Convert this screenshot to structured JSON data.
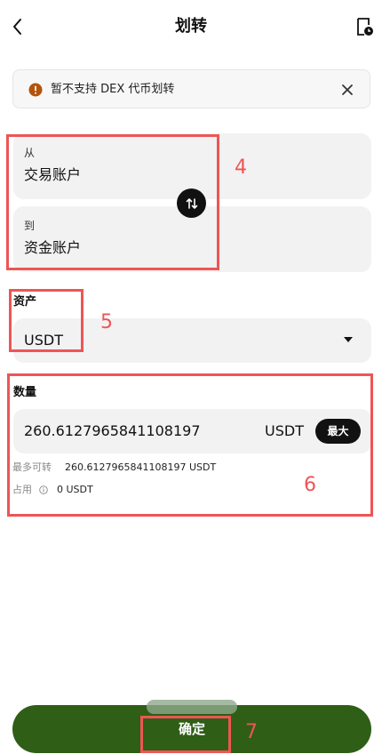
{
  "header": {
    "title": "划转",
    "back_icon": "chevron-left-icon",
    "history_icon": "document-clock-icon"
  },
  "notice": {
    "text": "暂不支持 DEX 代币划转",
    "warn_icon": "warning-circle-icon",
    "warn_color": "#b45309",
    "close_icon": "close-icon"
  },
  "transfer": {
    "from_label": "从",
    "from_value": "交易账户",
    "to_label": "到",
    "to_value": "资金账户",
    "swap_icon": "swap-vertical-icon"
  },
  "asset": {
    "label": "资产",
    "value": "USDT"
  },
  "amount": {
    "label": "数量",
    "value": "260.6127965841108197",
    "unit": "USDT",
    "max_label": "最大",
    "max_transferable_label": "最多可转",
    "max_transferable_value": "260.6127965841108197 USDT",
    "occupied_label": "占用",
    "occupied_value": "0 USDT"
  },
  "confirm": {
    "label": "确定",
    "color": "#2f5e17"
  },
  "annotations": {
    "n4": "4",
    "n5": "5",
    "n6": "6",
    "n7": "7",
    "color": "#ee5555"
  }
}
